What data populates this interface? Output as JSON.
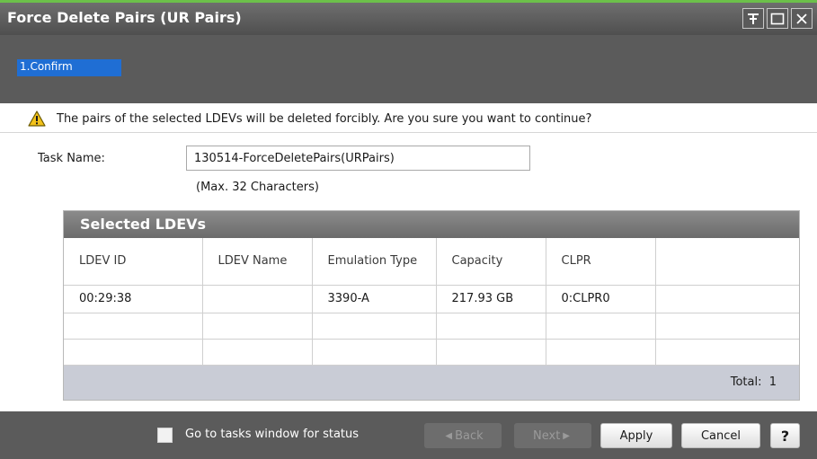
{
  "window": {
    "title": "Force Delete Pairs (UR Pairs)",
    "controls": [
      "pin-icon",
      "maximize-icon",
      "close-icon"
    ]
  },
  "steps": [
    {
      "label": "1.Confirm",
      "active": true
    }
  ],
  "warning": {
    "icon": "warning-icon",
    "text": "The pairs of the selected LDEVs will be deleted forcibly. Are you sure you want to continue?"
  },
  "task": {
    "label": "Task Name:",
    "value": "130514-ForceDeletePairs(URPairs)",
    "hint": "(Max. 32 Characters)"
  },
  "table": {
    "title": "Selected LDEVs",
    "columns": [
      "LDEV ID",
      "LDEV Name",
      "Emulation Type",
      "Capacity",
      "CLPR",
      ""
    ],
    "rows": [
      [
        "00:29:38",
        "",
        "3390-A",
        "217.93 GB",
        "0:CLPR0",
        ""
      ]
    ],
    "total": "Total:  1"
  },
  "footer": {
    "checkbox_label": "Go to tasks window for status",
    "checkbox_checked": false,
    "back_label": "Back",
    "next_label": "Next",
    "apply_label": "Apply",
    "cancel_label": "Cancel",
    "help_label": "?"
  },
  "colors": {
    "accent_top": "#6cc04a",
    "step_active": "#1f6ed4",
    "chrome": "#5b5b5b"
  }
}
